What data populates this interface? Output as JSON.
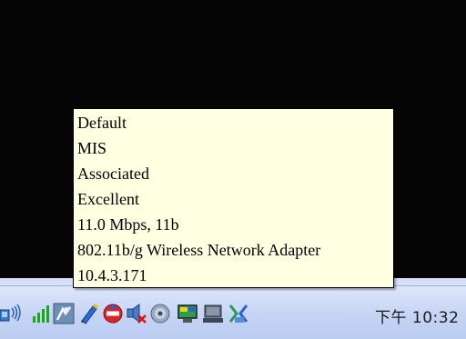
{
  "tooltip": {
    "lines": [
      "Default",
      "MIS",
      "Associated",
      "Excellent",
      "11.0 Mbps, 11b",
      "802.11b/g Wireless Network Adapter",
      "10.4.3.171"
    ]
  },
  "tray": {
    "icons": [
      "network-activity-icon",
      "signal-strength-icon",
      "security-shield-icon",
      "pen-tool-icon",
      "no-entry-icon",
      "speaker-muted-icon",
      "disc-icon",
      "monitor-display-icon",
      "laptop-icon",
      "network-connection-icon"
    ],
    "clock": "下午 10:32"
  },
  "colors": {
    "tooltip_bg": "#ffffe1",
    "screen_bg": "#050505",
    "taskbar_bg": "#c4d3f4"
  }
}
